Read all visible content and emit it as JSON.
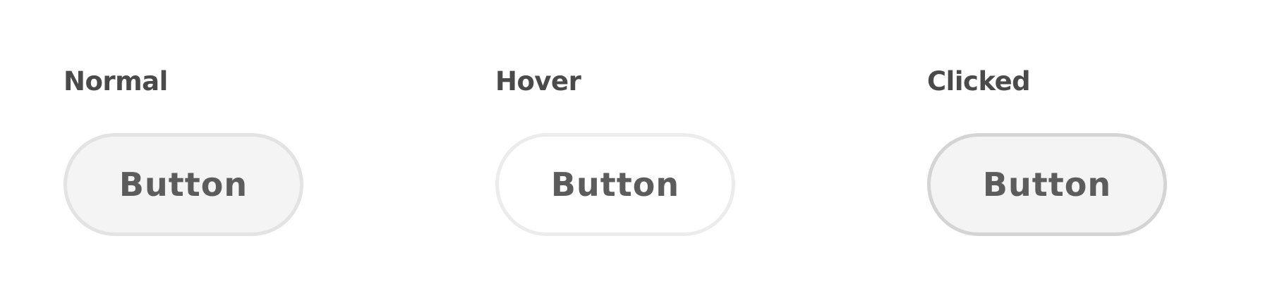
{
  "states": {
    "normal": {
      "label": "Normal",
      "button_label": "Button",
      "background_color": "#f4f4f4",
      "border_color": "#e3e3e3"
    },
    "hover": {
      "label": "Hover",
      "button_label": "Button",
      "background_color": "#ffffff",
      "border_color": "#ececec"
    },
    "clicked": {
      "label": "Clicked",
      "button_label": "Button",
      "background_color": "#f4f4f4",
      "border_color": "#d4d4d4"
    }
  },
  "colors": {
    "label_text": "#4a4a4a",
    "button_text": "#5c5c5c",
    "page_background": "#ffffff"
  }
}
